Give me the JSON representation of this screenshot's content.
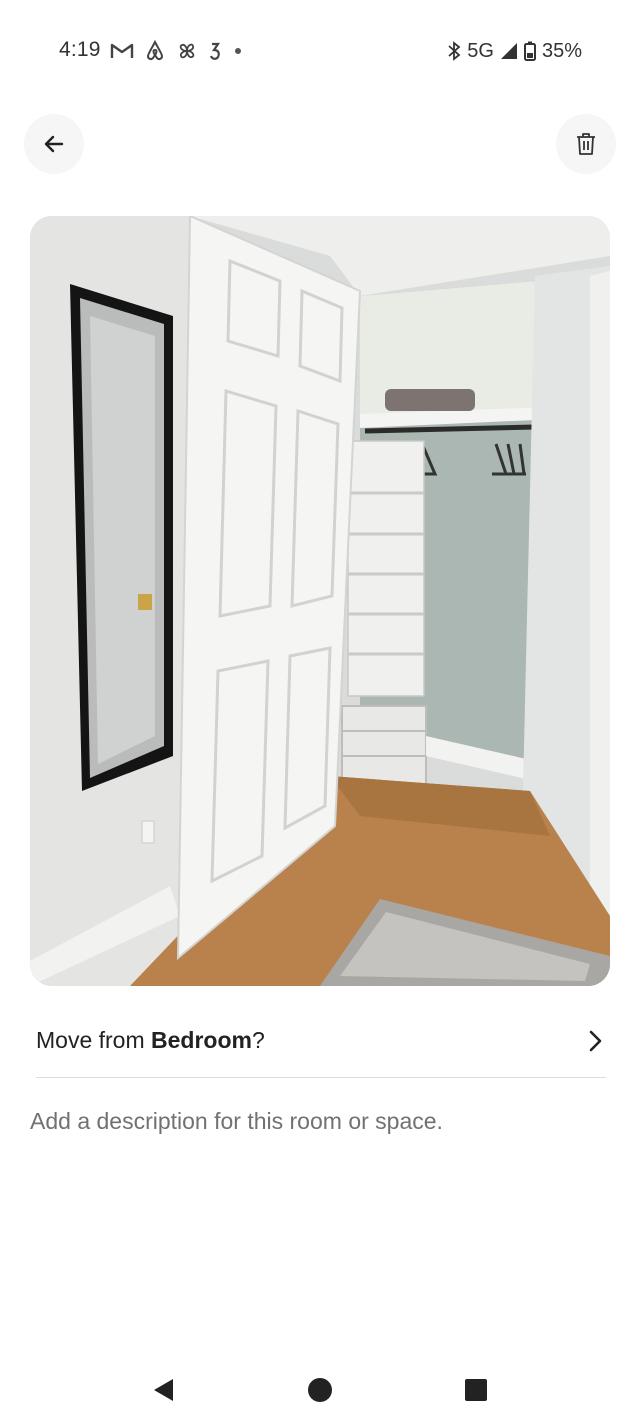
{
  "status_bar": {
    "time": "4:19",
    "network": "5G",
    "battery": "35%",
    "icons": [
      "gmail-icon",
      "airbnb-icon",
      "pinwheel-icon",
      "notification-icon",
      "dot-icon",
      "bluetooth-icon",
      "signal-icon",
      "battery-icon"
    ]
  },
  "header": {
    "back_icon": "arrow-left-icon",
    "delete_icon": "trash-icon"
  },
  "photo": {
    "subject": "closet photo"
  },
  "move_row": {
    "prefix": "Move from ",
    "room": "Bedroom",
    "suffix": "?",
    "icon": "chevron-right-icon"
  },
  "description": {
    "placeholder": "Add a description for this room or space."
  },
  "nav_bar": {
    "icons": [
      "back-triangle-icon",
      "home-circle-icon",
      "recents-square-icon"
    ]
  }
}
